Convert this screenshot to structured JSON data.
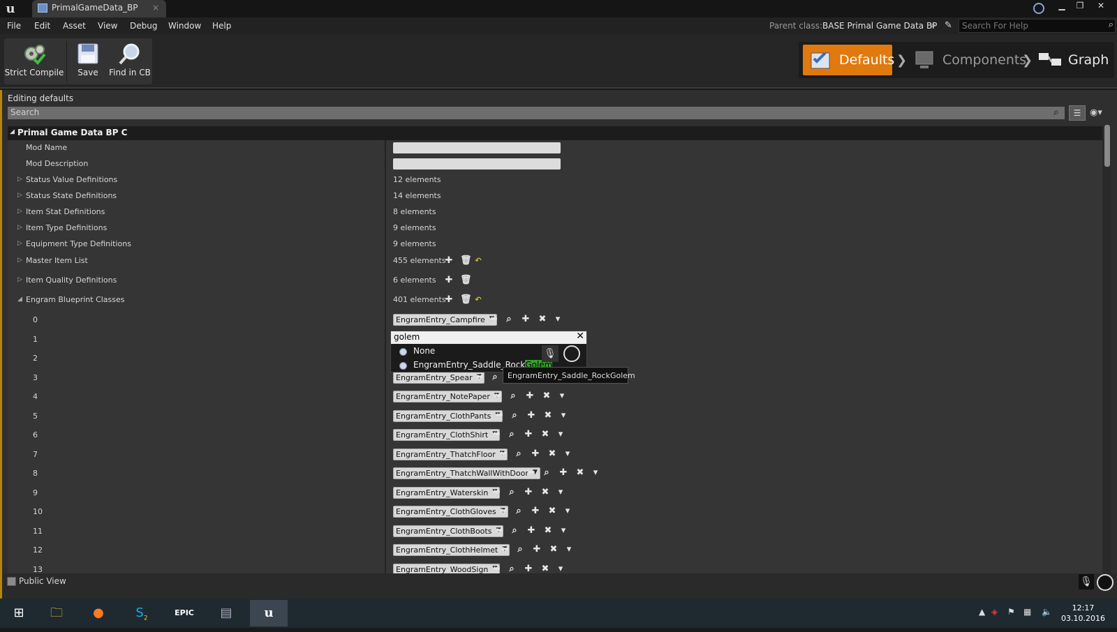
{
  "window": {
    "tab_title": "PrimalGameData_BP",
    "tab_close": "×",
    "controls": [
      "▁",
      "❐",
      "✕"
    ]
  },
  "menu": {
    "items": [
      "File",
      "Edit",
      "Asset",
      "View",
      "Debug",
      "Window",
      "Help"
    ],
    "parent_label": "Parent class:",
    "parent_value": "BASE Primal Game Data BP",
    "help_placeholder": "Search For Help"
  },
  "toolbar": {
    "strict_compile": "Strict Compile",
    "save": "Save",
    "find_in_cb": "Find in CB",
    "modes": [
      "Defaults",
      "Components",
      "Graph"
    ],
    "active_mode": "Defaults",
    "chevron": "❯"
  },
  "details": {
    "editing_label": "Editing defaults",
    "search_placeholder": "Search",
    "category": "Primal Game Data BP C",
    "rows": [
      {
        "name": "Mod Name",
        "type": "text"
      },
      {
        "name": "Mod Description",
        "type": "text"
      },
      {
        "name": "Status Value Definitions",
        "value": "12 elements"
      },
      {
        "name": "Status State Definitions",
        "value": "14 elements"
      },
      {
        "name": "Item Stat Definitions",
        "value": "8 elements"
      },
      {
        "name": "Item Type Definitions",
        "value": "9 elements"
      },
      {
        "name": "Equipment Type Definitions",
        "value": "9 elements"
      },
      {
        "name": "Master Item List",
        "value": "455 elements"
      },
      {
        "name": "Item Quality Definitions",
        "value": "6 elements"
      },
      {
        "name": "Engram Blueprint Classes",
        "value": "401 elements"
      }
    ],
    "array_items": [
      {
        "index": "0",
        "asset": "EngramEntry_Campfire"
      },
      {
        "index": "1",
        "asset": ""
      },
      {
        "index": "2",
        "asset": ""
      },
      {
        "index": "3",
        "asset": "EngramEntry_Spear"
      },
      {
        "index": "4",
        "asset": "EngramEntry_NotePaper"
      },
      {
        "index": "5",
        "asset": "EngramEntry_ClothPants"
      },
      {
        "index": "6",
        "asset": "EngramEntry_ClothShirt"
      },
      {
        "index": "7",
        "asset": "EngramEntry_ThatchFloor"
      },
      {
        "index": "8",
        "asset": "EngramEntry_ThatchWallWithDoor"
      },
      {
        "index": "9",
        "asset": "EngramEntry_Waterskin"
      },
      {
        "index": "10",
        "asset": "EngramEntry_ClothGloves"
      },
      {
        "index": "11",
        "asset": "EngramEntry_ClothBoots"
      },
      {
        "index": "12",
        "asset": "EngramEntry_ClothHelmet"
      },
      {
        "index": "13",
        "asset": "EngramEntry_WoodSign"
      }
    ],
    "public_view": "Public View"
  },
  "picker": {
    "query": "golem",
    "options": [
      "None",
      "EngramEntry_Saddle_Rock",
      "Golem"
    ],
    "tooltip": "EngramEntry_Saddle_RockGolem"
  },
  "taskbar": {
    "clock_time": "12:17",
    "clock_date": "03.10.2016",
    "skype_badge": "2",
    "epic_label": "EPIC"
  },
  "colors": {
    "accent": "#e07a0f",
    "highlight": "#36a02c"
  }
}
